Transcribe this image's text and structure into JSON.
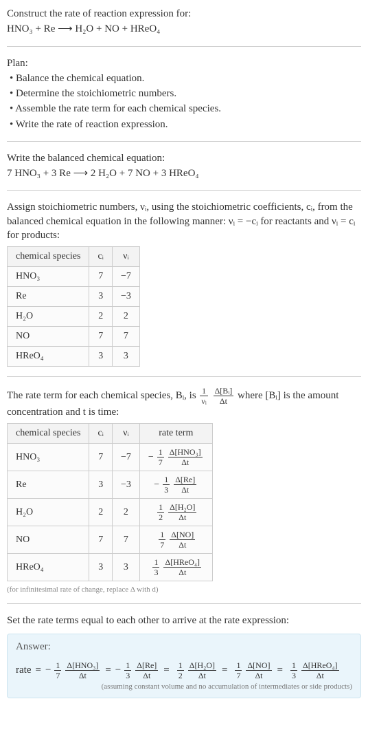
{
  "intro": {
    "construct": "Construct the rate of reaction expression for:",
    "equation": "HNO₃ + Re ⟶ H₂O + NO + HReO₄"
  },
  "plan": {
    "header": "Plan:",
    "b1": "• Balance the chemical equation.",
    "b2": "• Determine the stoichiometric numbers.",
    "b3": "• Assemble the rate term for each chemical species.",
    "b4": "• Write the rate of reaction expression."
  },
  "balanced": {
    "header": "Write the balanced chemical equation:",
    "equation": "7 HNO₃ + 3 Re ⟶ 2 H₂O + 7 NO + 3 HReO₄"
  },
  "stoich": {
    "text1": "Assign stoichiometric numbers, νᵢ, using the stoichiometric coefficients, cᵢ, from the balanced chemical equation in the following manner: νᵢ = −cᵢ for reactants and νᵢ = cᵢ for products:",
    "head_species": "chemical species",
    "head_c": "cᵢ",
    "head_v": "νᵢ",
    "r1_s": "HNO₃",
    "r1_c": "7",
    "r1_v": "−7",
    "r2_s": "Re",
    "r2_c": "3",
    "r2_v": "−3",
    "r3_s": "H₂O",
    "r3_c": "2",
    "r3_v": "2",
    "r4_s": "NO",
    "r4_c": "7",
    "r4_v": "7",
    "r5_s": "HReO₄",
    "r5_c": "3",
    "r5_v": "3"
  },
  "rateterm": {
    "pre": "The rate term for each chemical species, Bᵢ, is ",
    "frac1_num": "1",
    "frac1_den": "νᵢ",
    "frac2_num": "Δ[Bᵢ]",
    "frac2_den": "Δt",
    "mid": " where [Bᵢ] is the amount concentration and t is time:",
    "head_species": "chemical species",
    "head_c": "cᵢ",
    "head_v": "νᵢ",
    "head_rate": "rate term",
    "r1_s": "HNO₃",
    "r1_c": "7",
    "r1_v": "−7",
    "r1_sign": "−",
    "r1_f1n": "1",
    "r1_f1d": "7",
    "r1_f2n": "Δ[HNO₃]",
    "r1_f2d": "Δt",
    "r2_s": "Re",
    "r2_c": "3",
    "r2_v": "−3",
    "r2_sign": "−",
    "r2_f1n": "1",
    "r2_f1d": "3",
    "r2_f2n": "Δ[Re]",
    "r2_f2d": "Δt",
    "r3_s": "H₂O",
    "r3_c": "2",
    "r3_v": "2",
    "r3_sign": "",
    "r3_f1n": "1",
    "r3_f1d": "2",
    "r3_f2n": "Δ[H₂O]",
    "r3_f2d": "Δt",
    "r4_s": "NO",
    "r4_c": "7",
    "r4_v": "7",
    "r4_sign": "",
    "r4_f1n": "1",
    "r4_f1d": "7",
    "r4_f2n": "Δ[NO]",
    "r4_f2d": "Δt",
    "r5_s": "HReO₄",
    "r5_c": "3",
    "r5_v": "3",
    "r5_sign": "",
    "r5_f1n": "1",
    "r5_f1d": "3",
    "r5_f2n": "Δ[HReO₄]",
    "r5_f2d": "Δt",
    "note": "(for infinitesimal rate of change, replace Δ with d)"
  },
  "final": {
    "sentence": "Set the rate terms equal to each other to arrive at the rate expression:",
    "answer_label": "Answer:",
    "rate_word": "rate",
    "t1_sign": "−",
    "t1_f1n": "1",
    "t1_f1d": "7",
    "t1_f2n": "Δ[HNO₃]",
    "t1_f2d": "Δt",
    "t2_sign": "−",
    "t2_f1n": "1",
    "t2_f1d": "3",
    "t2_f2n": "Δ[Re]",
    "t2_f2d": "Δt",
    "t3_sign": "",
    "t3_f1n": "1",
    "t3_f1d": "2",
    "t3_f2n": "Δ[H₂O]",
    "t3_f2d": "Δt",
    "t4_sign": "",
    "t4_f1n": "1",
    "t4_f1d": "7",
    "t4_f2n": "Δ[NO]",
    "t4_f2d": "Δt",
    "t5_sign": "",
    "t5_f1n": "1",
    "t5_f1d": "3",
    "t5_f2n": "Δ[HReO₄]",
    "t5_f2d": "Δt",
    "assume": "(assuming constant volume and no accumulation of intermediates or side products)"
  }
}
